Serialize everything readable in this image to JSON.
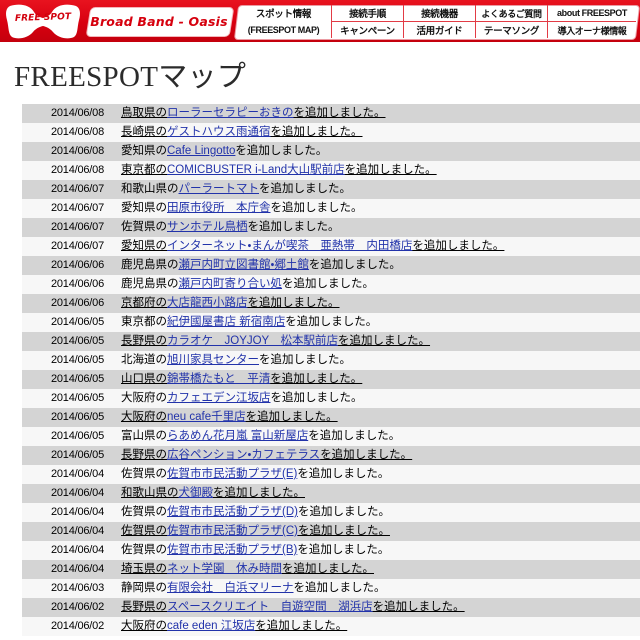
{
  "header": {
    "logo_text": "FREE SPOT",
    "logo_icon": "freespot-bowtie-logo",
    "brand_text": "Broad Band - Oasis",
    "nav": {
      "spot_line1": "スポット情報",
      "spot_line2": "(FREESPOT MAP)",
      "col2_top": "接続手順",
      "col2_bottom": "キャンペーン",
      "col3_top": "接続機器",
      "col3_bottom": "活用ガイド",
      "col4_top": "よくあるご質問",
      "col4_bottom": "テーマソング",
      "col5_top": "about FREESPOT",
      "col5_bottom": "導入オーナ様情報"
    },
    "colors": {
      "bar_red": "#e60012",
      "border_red": "#e23b45",
      "link_blue": "#2233aa",
      "row_gray": "#d4d4d4",
      "row_white": "#f7f7f7"
    }
  },
  "page_title": "FREESPOTマップ",
  "news": {
    "suffix": "を追加しました。",
    "rows": [
      {
        "date": "2014/06/08",
        "prefix": "鳥取県の",
        "link": "ローラーセラピーおきの",
        "underline_all": true,
        "latin": false
      },
      {
        "date": "2014/06/08",
        "prefix": "長崎県の",
        "link": "ゲストハウス雨通宿",
        "underline_all": true,
        "latin": false
      },
      {
        "date": "2014/06/08",
        "prefix": "愛知県の",
        "link": "Cafe Lingotto",
        "underline_all": false,
        "latin": true
      },
      {
        "date": "2014/06/08",
        "prefix": "東京都の",
        "link": "COMICBUSTER i-Land大山駅前店",
        "underline_all": true,
        "latin": false
      },
      {
        "date": "2014/06/07",
        "prefix": "和歌山県の",
        "link": "パーラートマト",
        "underline_all": false,
        "latin": false
      },
      {
        "date": "2014/06/07",
        "prefix": "愛知県の",
        "link": "田原市役所　本庁舎",
        "underline_all": false,
        "latin": false
      },
      {
        "date": "2014/06/07",
        "prefix": "佐賀県の",
        "link": "サンホテル鳥栖",
        "underline_all": false,
        "latin": false
      },
      {
        "date": "2014/06/07",
        "prefix": "愛知県の",
        "link": "インターネット・まんが喫茶　亜熱帯　内田橋店",
        "underline_all": true,
        "latin": false
      },
      {
        "date": "2014/06/06",
        "prefix": "鹿児島県の",
        "link": "瀬戸内町立図書館・郷土館",
        "underline_all": false,
        "latin": false
      },
      {
        "date": "2014/06/06",
        "prefix": "鹿児島県の",
        "link": "瀬戸内町寄り合い処",
        "underline_all": false,
        "latin": false
      },
      {
        "date": "2014/06/06",
        "prefix": "京都府の",
        "link": "大店龍西小路店",
        "underline_all": true,
        "latin": false
      },
      {
        "date": "2014/06/05",
        "prefix": "東京都の",
        "link": "紀伊國屋書店 新宿南店",
        "underline_all": false,
        "latin": false
      },
      {
        "date": "2014/06/05",
        "prefix": "長野県の",
        "link": "カラオケ　JOYJOY　松本駅前店",
        "underline_all": true,
        "latin": false
      },
      {
        "date": "2014/06/05",
        "prefix": "北海道の",
        "link": "旭川家具センター",
        "underline_all": false,
        "latin": false
      },
      {
        "date": "2014/06/05",
        "prefix": "山口県の",
        "link": "錦帯橋たもと　平清",
        "underline_all": true,
        "latin": false
      },
      {
        "date": "2014/06/05",
        "prefix": "大阪府の",
        "link": "カフェエデン江坂店",
        "underline_all": false,
        "latin": false
      },
      {
        "date": "2014/06/05",
        "prefix": "大阪府の",
        "link": "neu cafe千里店",
        "underline_all": true,
        "latin": false
      },
      {
        "date": "2014/06/05",
        "prefix": "富山県の",
        "link": "らあめん花月嵐 富山新屋店",
        "underline_all": false,
        "latin": false
      },
      {
        "date": "2014/06/05",
        "prefix": "長野県の",
        "link": "広谷ペンション・カフェテラス",
        "underline_all": true,
        "latin": false
      },
      {
        "date": "2014/06/04",
        "prefix": "佐賀県の",
        "link": "佐賀市市民活動プラザ(E)",
        "underline_all": false,
        "latin": false
      },
      {
        "date": "2014/06/04",
        "prefix": "和歌山県の",
        "link": "犬御殿",
        "underline_all": true,
        "latin": false
      },
      {
        "date": "2014/06/04",
        "prefix": "佐賀県の",
        "link": "佐賀市市民活動プラザ(D)",
        "underline_all": false,
        "latin": false
      },
      {
        "date": "2014/06/04",
        "prefix": "佐賀県の",
        "link": "佐賀市市民活動プラザ(C)",
        "underline_all": true,
        "latin": false
      },
      {
        "date": "2014/06/04",
        "prefix": "佐賀県の",
        "link": "佐賀市市民活動プラザ(B)",
        "underline_all": false,
        "latin": false
      },
      {
        "date": "2014/06/04",
        "prefix": "埼玉県の",
        "link": "ネット学園　休み時間",
        "underline_all": true,
        "latin": false
      },
      {
        "date": "2014/06/03",
        "prefix": "静岡県の",
        "link": "有限会社　白浜マリーナ",
        "underline_all": false,
        "latin": false
      },
      {
        "date": "2014/06/02",
        "prefix": "長野県の",
        "link": "スペースクリエイト　自遊空間　湖浜店",
        "underline_all": true,
        "latin": false
      },
      {
        "date": "2014/06/02",
        "prefix": "大阪府の",
        "link": "cafe eden 江坂店",
        "underline_all": true,
        "latin": false
      }
    ]
  }
}
